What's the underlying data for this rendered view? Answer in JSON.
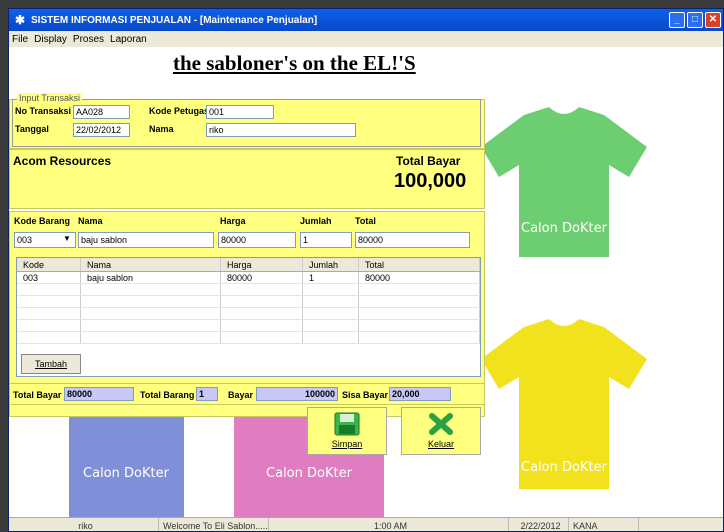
{
  "window": {
    "title": "SISTEM INFORMASI PENJUALAN - [Maintenance Penjualan]"
  },
  "menu": [
    "File",
    "Display",
    "Proses",
    "Laporan"
  ],
  "banner": "the sabloner's on the EL!'S",
  "input_transaksi": {
    "legend": "Input Transaksi",
    "no_label": "No Transaksi",
    "no_value": "AA028",
    "kode_label": "Kode Petugas",
    "kode_value": "001",
    "tanggal_label": "Tanggal",
    "tanggal_value": "22/02/2012",
    "nama_label": "Nama",
    "nama_value": "riko"
  },
  "company": "Acom Resources",
  "total_bayar_label": "Total Bayar",
  "total_bayar_value": "100,000",
  "item_entry": {
    "kode_label": "Kode Barang",
    "nama_label": "Nama",
    "harga_label": "Harga",
    "jumlah_label": "Jumlah",
    "total_label": "Total",
    "kode_value": "003",
    "nama_value": "baju sablon",
    "harga_value": "80000",
    "jumlah_value": "1",
    "total_value": "80000"
  },
  "grid": {
    "headers": [
      "Kode",
      "Nama",
      "Harga",
      "Jumlah",
      "Total"
    ],
    "rows": [
      [
        "003",
        "baju sablon",
        "80000",
        "1",
        "80000"
      ]
    ]
  },
  "buttons": {
    "tambah": "Tambah",
    "simpan": "Simpan",
    "keluar": "Keluar"
  },
  "footer": {
    "total_bayar_label": "Total Bayar",
    "total_bayar_value": "80000",
    "total_barang_label": "Total Barang",
    "total_barang_value": "1",
    "bayar_label": "Bayar",
    "bayar_value": "100000",
    "sisa_label": "Sisa Bayar",
    "sisa_value": "20,000"
  },
  "shirt_text": "Calon DoKter",
  "status": [
    "riko",
    "Welcome To Eli Sablon.....",
    "1:00 AM",
    "2/22/2012",
    "KANA"
  ]
}
